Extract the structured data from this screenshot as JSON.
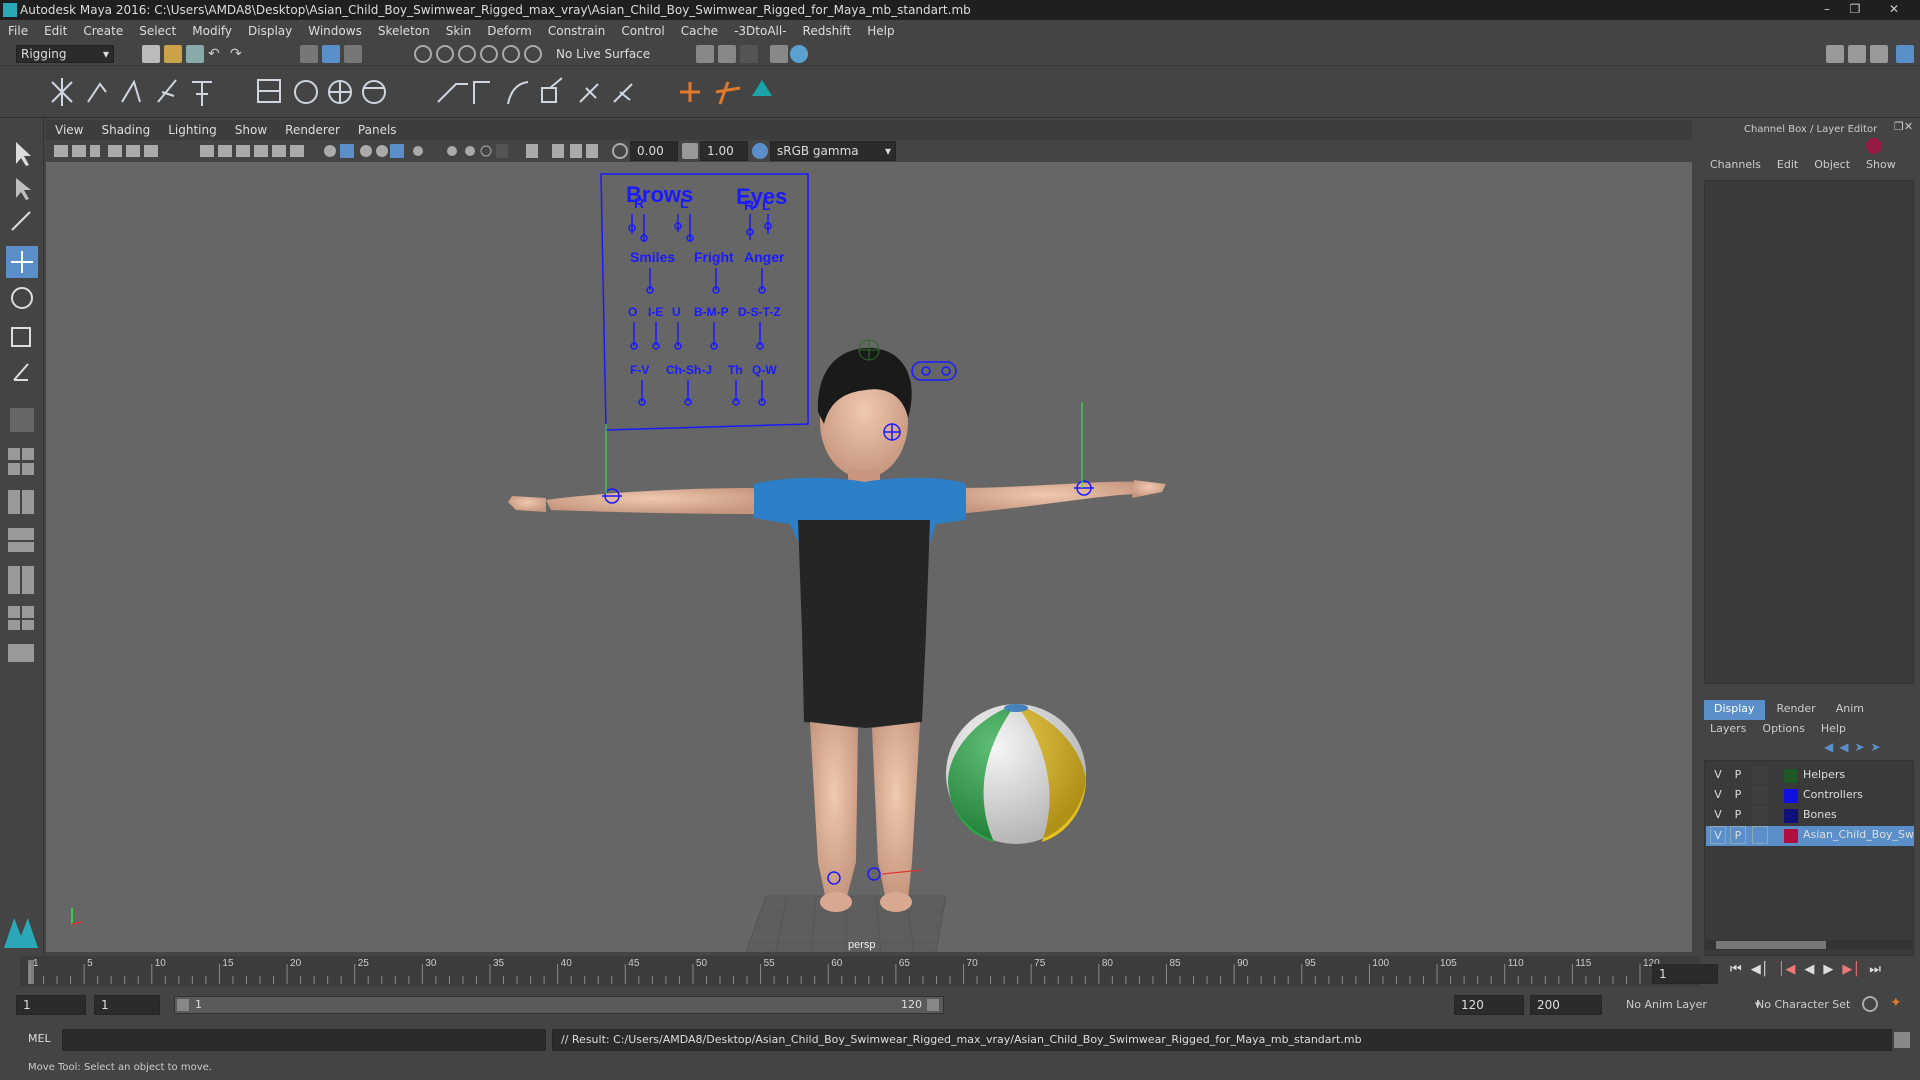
{
  "window": {
    "title": "Autodesk Maya 2016: C:\\Users\\AMDA8\\Desktop\\Asian_Child_Boy_Swimwear_Rigged_max_vray\\Asian_Child_Boy_Swimwear_Rigged_for_Maya_mb_standart.mb"
  },
  "menu": [
    "File",
    "Edit",
    "Create",
    "Select",
    "Modify",
    "Display",
    "Windows",
    "Skeleton",
    "Skin",
    "Deform",
    "Constrain",
    "Control",
    "Cache",
    "-3DtoAll-",
    "Redshift",
    "Help"
  ],
  "status": {
    "menuset": "Rigging",
    "live_surface": "No Live Surface"
  },
  "panel": {
    "menus": [
      "View",
      "Shading",
      "Lighting",
      "Show",
      "Renderer",
      "Panels"
    ],
    "exposure": "0.00",
    "gamma": "1.00",
    "colorspace": "sRGB gamma",
    "camera": "persp"
  },
  "facial_rig": {
    "brows": "Brows",
    "eyes": "Eyes",
    "r": "R",
    "l": "L",
    "smiles": "Smiles",
    "fright": "Fright",
    "anger": "Anger",
    "o": "O",
    "ie": "I-E",
    "u": "U",
    "bmp": "B-M-P",
    "dstz": "D-S-T-Z",
    "fv": "F-V",
    "chshj": "Ch-Sh-J",
    "th": "Th",
    "qw": "Q-W"
  },
  "channelbox": {
    "title": "Channel Box / Layer Editor",
    "menus": [
      "Channels",
      "Edit",
      "Object",
      "Show"
    ],
    "tabs": [
      "Display",
      "Render",
      "Anim"
    ],
    "layer_menus": [
      "Layers",
      "Options",
      "Help"
    ],
    "layers": [
      {
        "v": "V",
        "p": "P",
        "name": "Helpers",
        "color": "#1e5a28"
      },
      {
        "v": "V",
        "p": "P",
        "name": "Controllers",
        "color": "#1010e0"
      },
      {
        "v": "V",
        "p": "P",
        "name": "Bones",
        "color": "#10107a"
      },
      {
        "v": "V",
        "p": "P",
        "name": "Asian_Child_Boy_Swim",
        "color": "#b01040"
      }
    ]
  },
  "timeline": {
    "ticks": [
      "1",
      "5",
      "10",
      "15",
      "20",
      "25",
      "30",
      "35",
      "40",
      "45",
      "50",
      "55",
      "60",
      "65",
      "70",
      "75",
      "80",
      "85",
      "90",
      "95",
      "100",
      "105",
      "110",
      "115",
      "120"
    ],
    "current_frame": "1"
  },
  "range": {
    "start": "1",
    "start2": "1",
    "slider_start": "1",
    "slider_end": "120",
    "end": "120",
    "end2": "200",
    "anim_layer": "No Anim Layer",
    "char_set": "No Character Set"
  },
  "command": {
    "lang": "MEL",
    "result": "// Result: C:/Users/AMDA8/Desktop/Asian_Child_Boy_Swimwear_Rigged_max_vray/Asian_Child_Boy_Swimwear_Rigged_for_Maya_mb_standart.mb"
  },
  "help": {
    "text": "Move Tool: Select an object to move."
  },
  "colors": {
    "accent": "#5b8fc9",
    "ctrl": "#1a1aff",
    "bg_viewport": "#666666"
  }
}
